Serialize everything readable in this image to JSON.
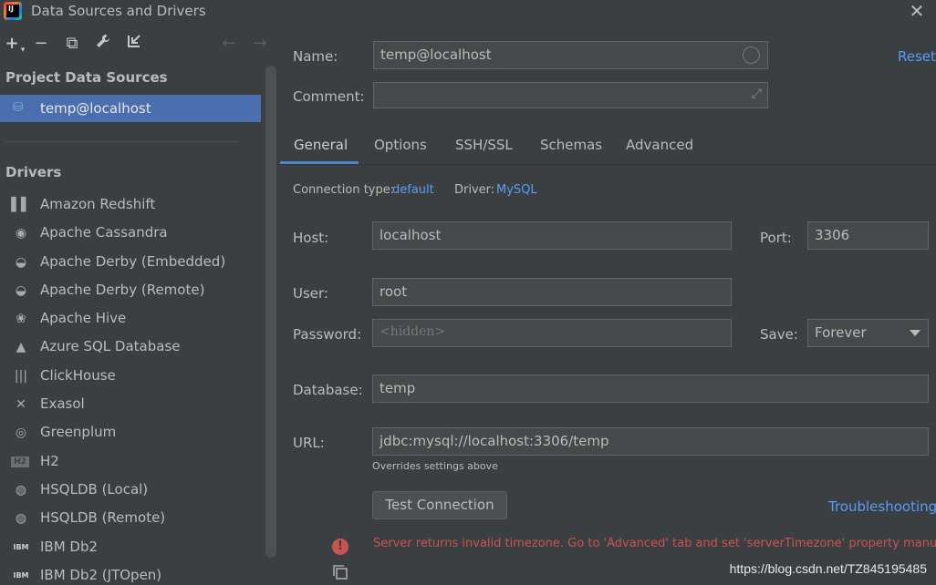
{
  "window": {
    "title": "Data Sources and Drivers"
  },
  "toolbar": {
    "add": "+",
    "add_arrow": "▾",
    "remove": "−",
    "copy": "⧉",
    "settings": "🔧",
    "import": "⇲",
    "back": "←",
    "forward": "→"
  },
  "sidebar": {
    "project_heading": "Project Data Sources",
    "project_items": [
      {
        "label": "temp@localhost"
      }
    ],
    "drivers_heading": "Drivers",
    "drivers": [
      {
        "label": "Amazon Redshift",
        "icon": "▌▌"
      },
      {
        "label": "Apache Cassandra",
        "icon": "◉"
      },
      {
        "label": "Apache Derby (Embedded)",
        "icon": "◒"
      },
      {
        "label": "Apache Derby (Remote)",
        "icon": "◒"
      },
      {
        "label": "Apache Hive",
        "icon": "❀"
      },
      {
        "label": "Azure SQL Database",
        "icon": "▲"
      },
      {
        "label": "ClickHouse",
        "icon": "|||"
      },
      {
        "label": "Exasol",
        "icon": "✕"
      },
      {
        "label": "Greenplum",
        "icon": "◎"
      },
      {
        "label": "H2",
        "icon": "H2"
      },
      {
        "label": "HSQLDB (Local)",
        "icon": "◍"
      },
      {
        "label": "HSQLDB (Remote)",
        "icon": "◍"
      },
      {
        "label": "IBM Db2",
        "icon": "IBM"
      },
      {
        "label": "IBM Db2 (JTOpen)",
        "icon": "IBM"
      }
    ]
  },
  "form": {
    "name_label": "Name:",
    "name_value": "temp@localhost",
    "reset": "Reset",
    "comment_label": "Comment:",
    "comment_value": "",
    "tabs": [
      "General",
      "Options",
      "SSH/SSL",
      "Schemas",
      "Advanced"
    ],
    "connection_type_label": "Connection type:",
    "connection_type_value": "default",
    "driver_label": "Driver:",
    "driver_value": "MySQL",
    "host_label": "Host:",
    "host_value": "localhost",
    "port_label": "Port:",
    "port_value": "3306",
    "user_label": "User:",
    "user_value": "root",
    "password_label": "Password:",
    "password_placeholder": "<hidden>",
    "save_label": "Save:",
    "save_value": "Forever",
    "database_label": "Database:",
    "database_value": "temp",
    "url_label": "URL:",
    "url_value": "jdbc:mysql://localhost:3306/temp",
    "url_hint": "Overrides settings above",
    "test_connection": "Test Connection",
    "troubleshooting": "Troubleshooting",
    "error_message": "Server returns invalid timezone. Go to 'Advanced' tab and set 'serverTimezone' property manually."
  },
  "watermark": "https://blog.csdn.net/TZ845195485",
  "colors": {
    "accent": "#4b6eaf",
    "link": "#589df6",
    "error": "#c75450",
    "background": "#3c3f41"
  }
}
